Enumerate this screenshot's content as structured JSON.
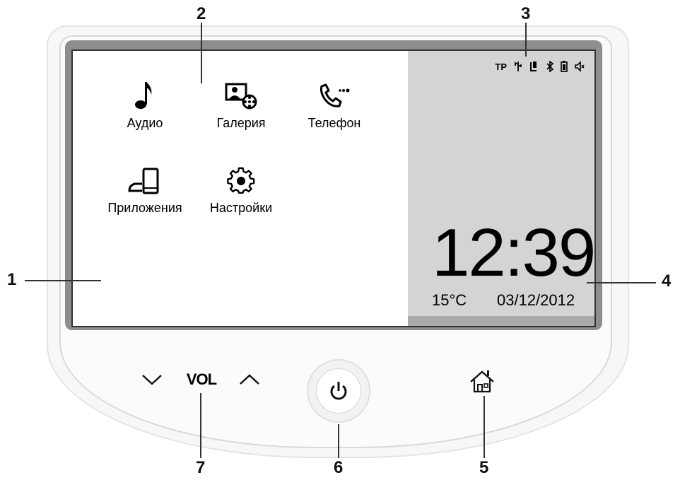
{
  "callouts": {
    "n1": "1",
    "n2": "2",
    "n3": "3",
    "n4": "4",
    "n5": "5",
    "n6": "6",
    "n7": "7"
  },
  "home_screen": {
    "apps": [
      {
        "label": "Аудио",
        "icon": "music-note-icon"
      },
      {
        "label": "Галерия",
        "icon": "gallery-icon"
      },
      {
        "label": "Телефон",
        "icon": "phone-icon"
      },
      {
        "label": "Приложения",
        "icon": "apps-phone-icon"
      },
      {
        "label": "Настройки",
        "icon": "settings-gear-icon"
      }
    ]
  },
  "status_bar": {
    "tp": "TP",
    "icons": [
      "usb-icon",
      "phone-connected-icon",
      "bluetooth-icon",
      "battery-icon",
      "speaker-mute-icon"
    ]
  },
  "clock": {
    "time": "12:39",
    "temperature": "15°C",
    "date": "03/12/2012"
  },
  "hardware": {
    "vol_label": "VOL",
    "buttons": [
      "vol-down-icon",
      "vol-up-icon",
      "power-icon",
      "home-icon"
    ]
  },
  "colors": {
    "screen_status_panel": "#d4d4d4",
    "screen_frame": "#8e8e8e",
    "status_bottom_bar": "#aaaaaa"
  }
}
